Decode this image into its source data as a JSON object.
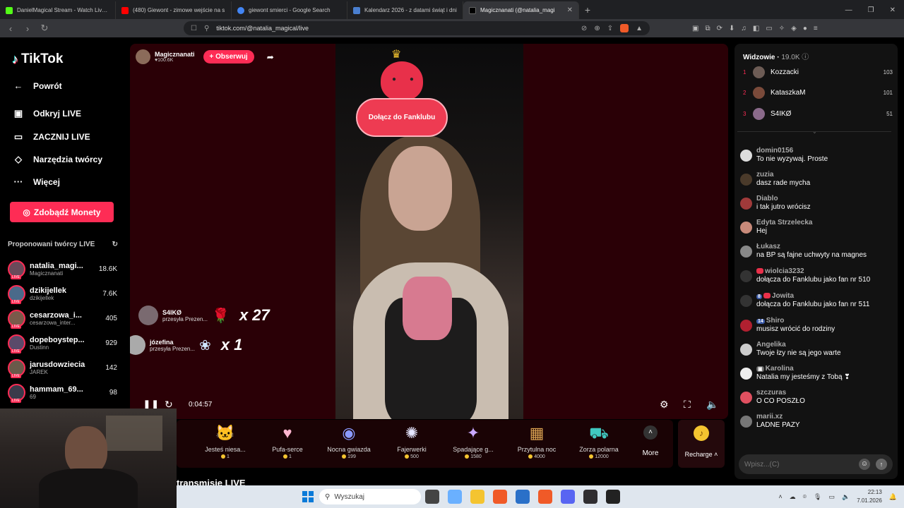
{
  "browser": {
    "tabs": [
      {
        "title": "DanielMagical Stream - Watch Live o",
        "color": "#53fc18",
        "active": false
      },
      {
        "title": "(480) Giewont - zimowe wejście na s",
        "color": "#ff0000",
        "active": false
      },
      {
        "title": "giewont smierci - Google Search",
        "color": "#4285f4",
        "active": false
      },
      {
        "title": "Kalendarz 2026 - z datami świąt i dni",
        "color": "#4a7fd0",
        "active": false
      },
      {
        "title": "Magicznanati (@natalia_magi",
        "color": "#000000",
        "active": true
      }
    ],
    "url": "tiktok.com/@natalia_magical/live"
  },
  "sidebar": {
    "logo": "TikTok",
    "items": [
      {
        "label": "Powrót",
        "icon": "arrow-left-icon"
      },
      {
        "label": "Odkryj LIVE",
        "icon": "live-tv-icon"
      },
      {
        "label": "ZACZNIJ LIVE",
        "icon": "camera-icon"
      },
      {
        "label": "Narzędzia twórcy",
        "icon": "tools-icon"
      },
      {
        "label": "Więcej",
        "icon": "more-dots-icon"
      }
    ],
    "coins_button": "Zdobądź Monety",
    "suggested_title": "Proponowani twórcy LIVE",
    "creators": [
      {
        "name": "natalia_magi...",
        "sub": "Magicznanati",
        "count": "18.6K"
      },
      {
        "name": "dzikijellek",
        "sub": "dzikijellek",
        "count": "7.6K"
      },
      {
        "name": "cesarzowa_i...",
        "sub": "cesarzowa_inter...",
        "count": "405"
      },
      {
        "name": "dopeboystep...",
        "sub": "Dustinn",
        "count": "929"
      },
      {
        "name": "jarusdowziecia",
        "sub": "JAREK",
        "count": "142"
      },
      {
        "name": "hammam_69...",
        "sub": "69",
        "count": "98"
      }
    ]
  },
  "stream": {
    "host_name": "Magicznanati",
    "host_likes": "100.6K",
    "follow_label": "+ Obserwuj",
    "fanclub_text": "Dołącz do Fanklubu",
    "gift_messages": [
      {
        "user": "S4IKØ",
        "text": "przesyła Prezen...",
        "multiplier": "x 27",
        "icon": "rose-icon"
      },
      {
        "user": "józefina",
        "text": "przesyła Prezen...",
        "multiplier": "x 1",
        "icon": "wings-icon"
      }
    ],
    "time": "0:04:57"
  },
  "gifts": [
    {
      "label": "Jesteś niesa...",
      "price": "1",
      "icon": "cat-icon"
    },
    {
      "label": "Pufa-serce",
      "price": "1",
      "icon": "heart-puff-icon"
    },
    {
      "label": "Nocna gwiazda",
      "price": "199",
      "icon": "night-star-icon"
    },
    {
      "label": "Fajerwerki",
      "price": "500",
      "icon": "fireworks-icon"
    },
    {
      "label": "Spadające g...",
      "price": "1580",
      "icon": "shooting-star-icon"
    },
    {
      "label": "Przytulna noc",
      "price": "4000",
      "icon": "cozy-night-icon"
    },
    {
      "label": "Zorza polarna",
      "price": "12000",
      "icon": "aurora-icon"
    }
  ],
  "more_label": "More",
  "recharge_label": "Recharge",
  "live_section_title": "transmisje LIVE",
  "chat": {
    "title": "Widzowie",
    "viewers": "19.0K",
    "ranking": [
      {
        "rank": "1",
        "name": "Kozzacki",
        "value": "103"
      },
      {
        "rank": "2",
        "name": "KataszkaM",
        "value": "101"
      },
      {
        "rank": "3",
        "name": "S4IKØ",
        "value": "51"
      }
    ],
    "messages": [
      {
        "user": "domin0156",
        "text": "To nie wyzywaj. Proste"
      },
      {
        "user": "zuzia",
        "text": "dasz rade mycha"
      },
      {
        "user": "Diablo",
        "text": "i tak jutro wrócisz"
      },
      {
        "user": "Edyta Strzelecka",
        "text": "Hej"
      },
      {
        "user": "Łukasz",
        "text": "na BP są fajne uchwyty na magnes"
      },
      {
        "user": "wiolcia3232",
        "text": "dołącza do Fanklubu jako fan nr 510",
        "badge": "heart"
      },
      {
        "user": "Jowita",
        "text": "dołącza do Fanklubu jako fan nr 511",
        "badge": "8"
      },
      {
        "user": "Shiro",
        "text": "musisz wrócić do rodziny",
        "badge": "14"
      },
      {
        "user": "Angelika",
        "text": "Twoje łzy nie są jego warte"
      },
      {
        "user": "Karolina",
        "text": "Natalia my jesteśmy z Tobą ❣"
      },
      {
        "user": "szczuras",
        "text": "O CO POSZŁO"
      },
      {
        "user": "marii.xz",
        "text": "LADNE PAZY"
      }
    ],
    "input_placeholder": "Wpisz...(C)"
  },
  "taskbar": {
    "search": "Wyszukaj",
    "time": "22:13",
    "date": "7.01.2026"
  }
}
